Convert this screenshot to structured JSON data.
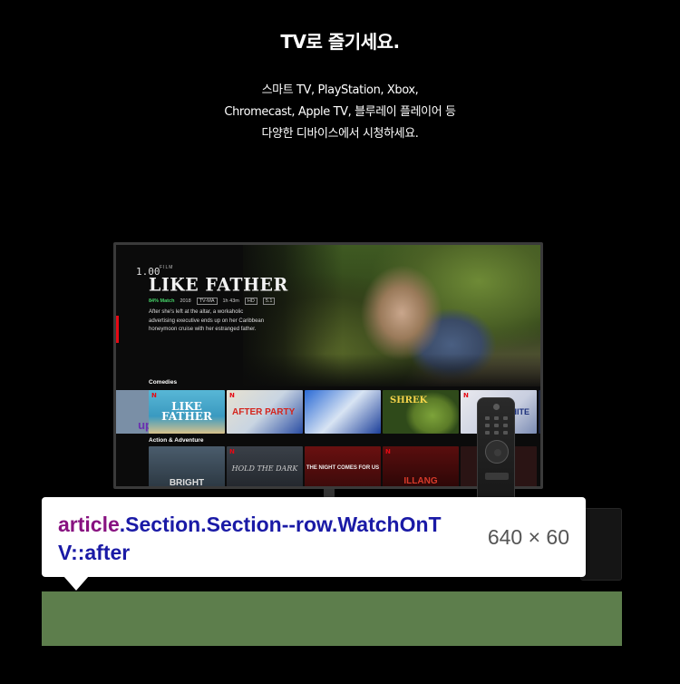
{
  "section": {
    "title": "TV로 즐기세요.",
    "subtitle_lines": [
      "스마트 TV, PlayStation, Xbox,",
      "Chromecast, Apple TV, 블루레이 플레이어 등",
      "다양한 디바이스에서 시청하세요."
    ]
  },
  "tv_ui": {
    "player_time": "1.00",
    "film_tag": "FILM",
    "show_title": "LIKE FATHER",
    "meta": {
      "match": "84% Match",
      "year": "2018",
      "rating": "TV-MA",
      "duration": "1h 43m",
      "quality": "HD",
      "audio": "5.1"
    },
    "synopsis": "After she's left at the altar, a workaholic advertising executive ends up on her Caribbean honeymoon cruise with her estranged father.",
    "rows": [
      {
        "label": "Comedies",
        "tiles": [
          "up",
          "LIKE FATHER",
          "AFTER PARTY",
          "",
          "SHREK",
          "RON WHITE",
          ""
        ]
      },
      {
        "label": "Action & Adventure",
        "tiles": [
          "BRIGHT",
          "HOLD THE DARK",
          "THE NIGHT COMES FOR US",
          "ILLANG",
          "N"
        ]
      }
    ],
    "netflix_logo": "N",
    "colors": {
      "netflix_red": "#e50914",
      "match_green": "#46d369"
    }
  },
  "devtools": {
    "selector_tag": "article",
    "selector_rest": ".Section.Section--row.WatchOnTV::after",
    "size": "640 × 60",
    "highlight_color": "#5d7e4c"
  }
}
